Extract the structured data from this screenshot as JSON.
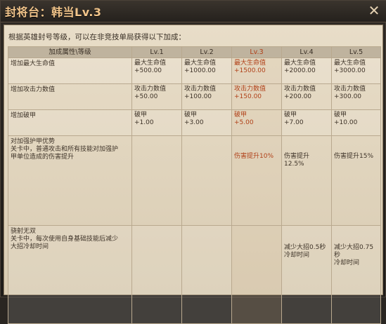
{
  "window": {
    "title": "封将台：韩当Lv.3",
    "close_icon": "close-icon"
  },
  "intro": "根据英雄封号等级，可以在非竞技单局获得以下加成：",
  "table": {
    "header": [
      "加成属性\\等级",
      "Lv.1",
      "Lv.2",
      "Lv.3",
      "Lv.4",
      "Lv.5"
    ],
    "current_level_index": 3,
    "rows": [
      {
        "attribute": "增加最大生命值",
        "values": [
          "最大生命值\n+500.00",
          "最大生命值\n+1000.00",
          "最大生命值\n+1500.00",
          "最大生命值\n+2000.00",
          "最大生命值\n+3000.00"
        ]
      },
      {
        "attribute": "增加攻击力数值",
        "values": [
          "攻击力数值\n+50.00",
          "攻击力数值\n+100.00",
          "攻击力数值\n+150.00",
          "攻击力数值\n+200.00",
          "攻击力数值\n+300.00"
        ]
      },
      {
        "attribute": "增加破甲",
        "values": [
          "破甲\n+1.00",
          "破甲\n+3.00",
          "破甲\n+5.00",
          "破甲\n+7.00",
          "破甲\n+10.00"
        ]
      },
      {
        "attribute": "对加强护甲优势\n关卡中，普通攻击和所有技能对加强护\n甲单位造成的伤害提升",
        "values": [
          "",
          "",
          "伤害提升10%",
          "伤害提升12.5%",
          "伤害提升15%"
        ]
      },
      {
        "attribute": "骁射无双\n关卡中，每次使用自身基础技能后减少\n大招冷却时间",
        "values": [
          "",
          "",
          "",
          "减少大招0.5秒\n冷却时间",
          "减少大招0.75秒\n冷却时间"
        ]
      }
    ]
  },
  "colors": {
    "title": "#f1c48a",
    "highlight": "#b04018",
    "panel": "#e3d7c0"
  }
}
